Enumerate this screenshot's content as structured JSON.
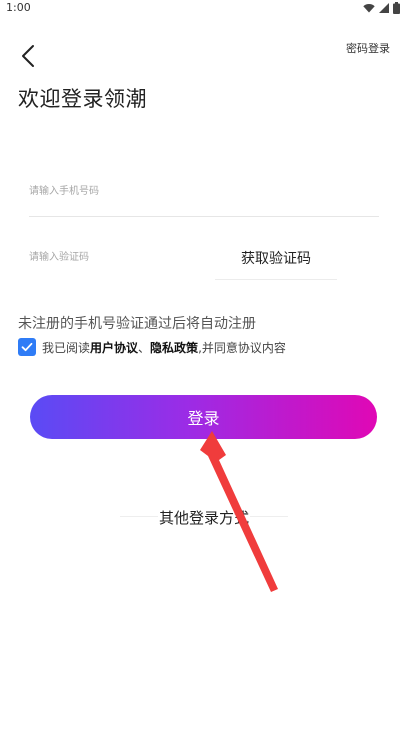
{
  "status_bar": {
    "time": "1:00"
  },
  "header": {
    "password_login": "密码登录",
    "title": "欢迎登录领潮"
  },
  "form": {
    "phone_placeholder": "请输入手机号码",
    "code_placeholder": "请输入验证码",
    "get_code_label": "获取验证码",
    "notice": "未注册的手机号验证通过后将自动注册",
    "agree_prefix": "我已阅读",
    "user_agreement": "用户协议",
    "separator": "、",
    "privacy_policy": "隐私政策",
    "agree_suffix": ",并同意协议内容",
    "agree_checked": true,
    "login_label": "登录"
  },
  "other": {
    "label": "其他登录方式"
  },
  "colors": {
    "accent": "#2f7cf6",
    "gradient_start": "#5a4bf5",
    "gradient_end": "#e008b5",
    "annotation": "#f03c3c"
  }
}
